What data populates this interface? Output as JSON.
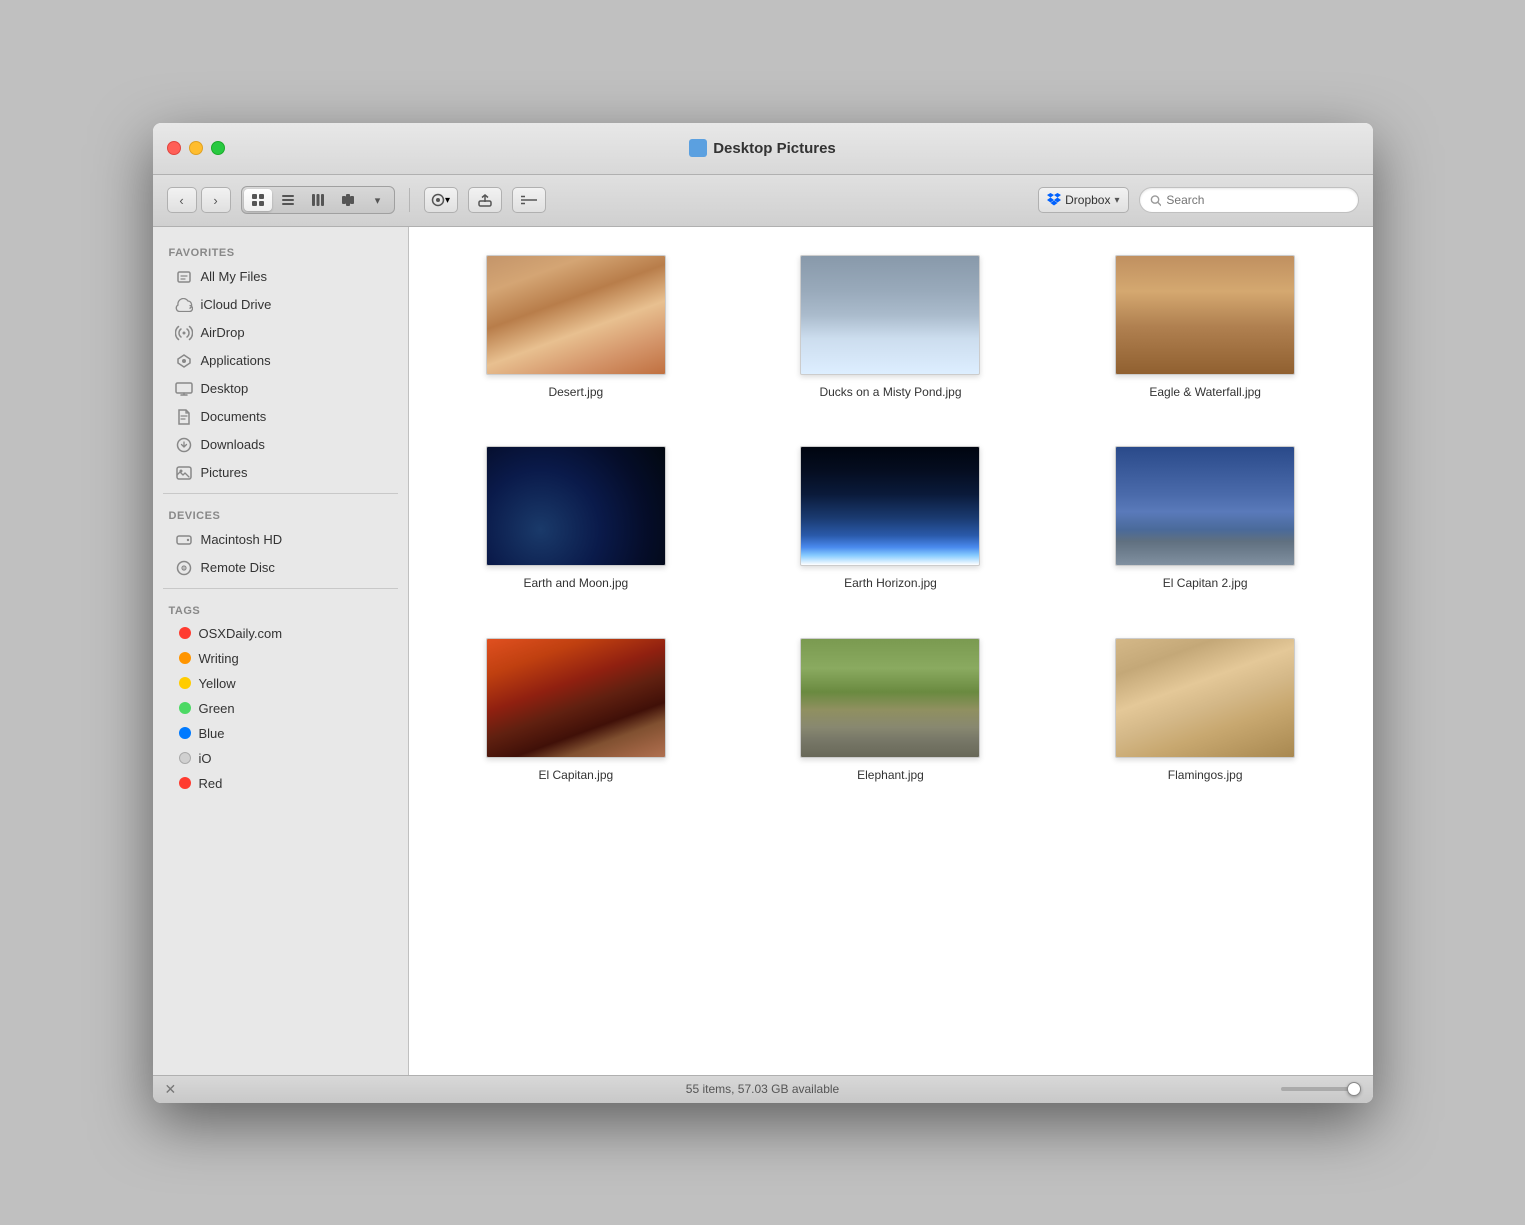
{
  "window": {
    "title": "Desktop Pictures",
    "title_icon_color": "#5ba0e0"
  },
  "toolbar": {
    "back_label": "‹",
    "forward_label": "›",
    "view_icon": "⊞",
    "list_icon": "≡",
    "column_icon": "⊟",
    "cover_icon": "⊠",
    "view_options_icon": "⊞",
    "action_icon": "⚙",
    "share_icon": "↑",
    "path_icon": "—",
    "dropbox_label": "Dropbox",
    "search_placeholder": "Search"
  },
  "sidebar": {
    "favorites_label": "Favorites",
    "favorites_items": [
      {
        "id": "all-my-files",
        "label": "All My Files",
        "icon": "📋"
      },
      {
        "id": "icloud-drive",
        "label": "iCloud Drive",
        "icon": "☁"
      },
      {
        "id": "airdrop",
        "label": "AirDrop",
        "icon": "📡"
      },
      {
        "id": "applications",
        "label": "Applications",
        "icon": "🚀"
      },
      {
        "id": "desktop",
        "label": "Desktop",
        "icon": "🖥"
      },
      {
        "id": "documents",
        "label": "Documents",
        "icon": "📄"
      },
      {
        "id": "downloads",
        "label": "Downloads",
        "icon": "⬇"
      },
      {
        "id": "pictures",
        "label": "Pictures",
        "icon": "📷"
      }
    ],
    "devices_label": "Devices",
    "devices_items": [
      {
        "id": "macintosh-hd",
        "label": "Macintosh HD",
        "icon": "💿"
      },
      {
        "id": "remote-disc",
        "label": "Remote Disc",
        "icon": "💿"
      }
    ],
    "tags_label": "Tags",
    "tags_items": [
      {
        "id": "osxdaily",
        "label": "OSXDaily.com",
        "color": "#ff3b30"
      },
      {
        "id": "writing",
        "label": "Writing",
        "color": "#ff9500"
      },
      {
        "id": "yellow",
        "label": "Yellow",
        "color": "#ffcc00"
      },
      {
        "id": "green",
        "label": "Green",
        "color": "#4cd964"
      },
      {
        "id": "blue",
        "label": "Blue",
        "color": "#007aff"
      },
      {
        "id": "io",
        "label": "iO",
        "color": "#d0d0d0"
      },
      {
        "id": "red",
        "label": "Red",
        "color": "#ff3b30"
      }
    ]
  },
  "files": [
    {
      "id": "desert",
      "name": "Desert.jpg",
      "thumb_class": "desert-img"
    },
    {
      "id": "ducks",
      "name": "Ducks on a Misty\nPond.jpg",
      "thumb_class": "ducks-img"
    },
    {
      "id": "eagle",
      "name": "Eagle & Waterfall.jpg",
      "thumb_class": "eagle-img"
    },
    {
      "id": "earth-moon",
      "name": "Earth and Moon.jpg",
      "thumb_class": "earth-moon-img"
    },
    {
      "id": "earth-horizon",
      "name": "Earth Horizon.jpg",
      "thumb_class": "earth-horizon-img"
    },
    {
      "id": "el-capitan-2",
      "name": "El Capitan 2.jpg",
      "thumb_class": "el-capitan2-img"
    },
    {
      "id": "el-capitan",
      "name": "El Capitan.jpg",
      "thumb_class": "el-capitan-img"
    },
    {
      "id": "elephant",
      "name": "Elephant.jpg",
      "thumb_class": "elephant-img"
    },
    {
      "id": "flamingos",
      "name": "Flamingos.jpg",
      "thumb_class": "flamingos-img"
    }
  ],
  "statusbar": {
    "text": "55 items, 57.03 GB available",
    "settings_icon": "✕"
  }
}
